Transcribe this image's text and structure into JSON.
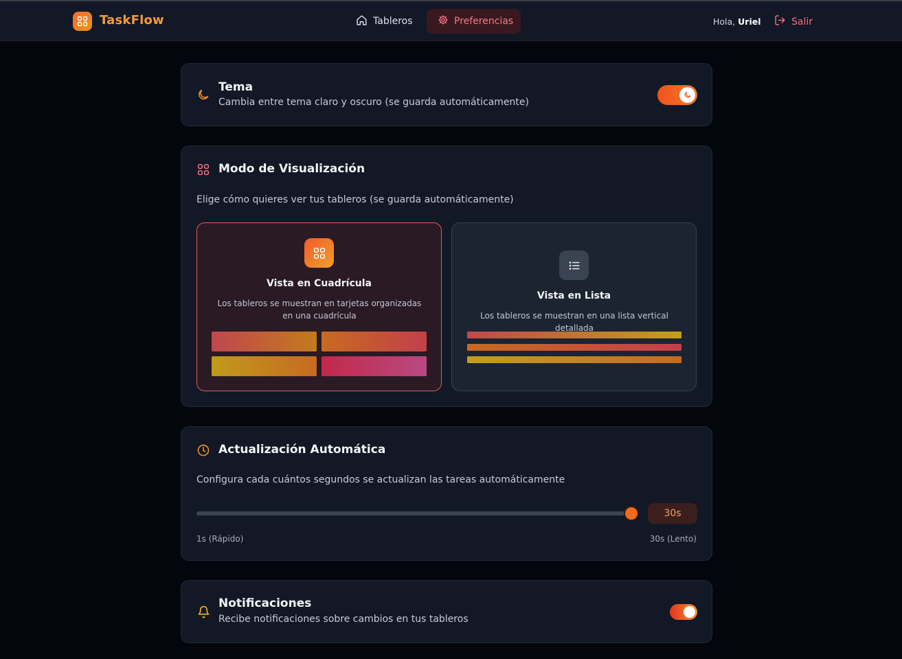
{
  "header": {
    "brand": "TaskFlow",
    "nav": [
      {
        "label": "Tableros",
        "icon": "home-icon",
        "active": false
      },
      {
        "label": "Preferencias",
        "icon": "settings-icon",
        "active": true
      }
    ],
    "greeting": "Hola,",
    "username": "Uriel",
    "logout_label": "Salir"
  },
  "theme": {
    "title": "Tema",
    "subtitle": "Cambia entre tema claro y oscuro (se guarda automáticamente)",
    "icon": "moon-icon",
    "toggle_on": true
  },
  "view_mode": {
    "title": "Modo de Visualización",
    "icon": "grid-icon",
    "description": "Elige cómo quieres ver tus tableros (se guarda automáticamente)",
    "options": [
      {
        "title": "Vista en Cuadrícula",
        "text": "Los tableros se muestran en tarjetas organizadas en una cuadrícula",
        "icon": "grid-icon",
        "selected": true
      },
      {
        "title": "Vista en Lista",
        "text": "Los tableros se muestran en una lista vertical detallada",
        "icon": "list-icon",
        "selected": false
      }
    ]
  },
  "auto_update": {
    "title": "Actualización Automática",
    "icon": "clock-icon",
    "description": "Configura cada cuántos segundos se actualizan las tareas automáticamente",
    "value_label": "30s",
    "value_seconds": 30,
    "min_label": "1s (Rápido)",
    "max_label": "30s (Lento)"
  },
  "notifications": {
    "title": "Notificaciones",
    "subtitle": "Recibe notificaciones sobre cambios en tus tableros",
    "icon": "bell-icon",
    "toggle_on": true
  },
  "colors": {
    "accent": "#f26a1e",
    "danger": "#f4707c",
    "background": "#03060d",
    "card": "#121826"
  }
}
